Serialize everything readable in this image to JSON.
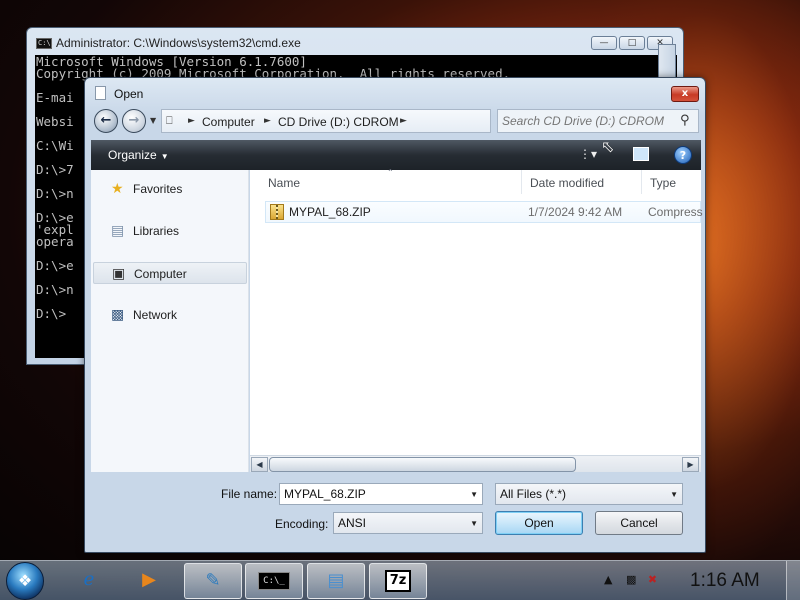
{
  "cmd": {
    "title": "Administrator: C:\\Windows\\system32\\cmd.exe",
    "icon_text": "C:\\.",
    "lines": [
      "Microsoft Windows [Version 6.1.7600]",
      "Copyright (c) 2009 Microsoft Corporation.  All rights reserved.",
      "",
      "E-mai",
      "",
      "Websi",
      "",
      "C:\\Wi",
      "",
      "D:\\>7",
      "",
      "D:\\>n",
      "",
      "D:\\>e",
      "'expl",
      "opera",
      "",
      "D:\\>e",
      "",
      "D:\\>n",
      "",
      "D:\\>"
    ]
  },
  "dialog": {
    "title": "Open",
    "close_label": "x",
    "breadcrumbs": [
      "Computer",
      "CD Drive (D:) CDROM"
    ],
    "search_placeholder": "Search CD Drive (D:) CDROM",
    "toolbar": {
      "organize": "Organize"
    },
    "nav": [
      {
        "label": "Favorites",
        "icon": "star-icon"
      },
      {
        "label": "Libraries",
        "icon": "libraries-icon"
      },
      {
        "label": "Computer",
        "icon": "computer-icon"
      },
      {
        "label": "Network",
        "icon": "network-icon"
      }
    ],
    "columns": [
      "Name",
      "Date modified",
      "Type"
    ],
    "files": [
      {
        "name": "MYPAL_68.ZIP",
        "date": "1/7/2024 9:42 AM",
        "type": "Compress"
      }
    ],
    "file_name_label": "File name:",
    "file_name_value": "MYPAL_68.ZIP",
    "file_type_value": "All Files  (*.*)",
    "encoding_label": "Encoding:",
    "encoding_value": "ANSI",
    "open_label": "Open",
    "cancel_label": "Cancel"
  },
  "taskbar": {
    "clock": "1:16 AM",
    "apps": [
      "explorer-icon",
      "media-player-icon",
      "notepad-icon",
      "cmd-icon",
      "zip-explorer-icon",
      "7zip-icon"
    ],
    "cmd_icon_text": "C:\\_",
    "sevenzip_text": "7z"
  }
}
